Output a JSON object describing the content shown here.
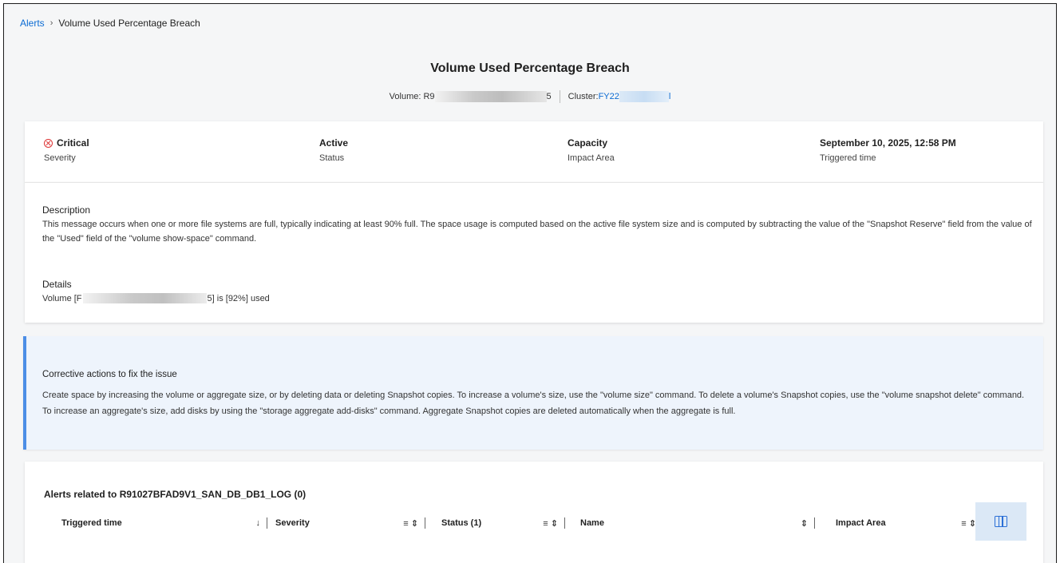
{
  "breadcrumb": {
    "link": "Alerts",
    "separator": "›",
    "current": "Volume Used Percentage Breach"
  },
  "header": {
    "title": "Volume Used Percentage Breach",
    "volume_label": "Volume: R9",
    "volume_suffix": "5",
    "cluster_label": "Cluster: ",
    "cluster_value": "FY22",
    "cluster_suffix": "l"
  },
  "summary": {
    "severity_value": "Critical",
    "severity_label": "Severity",
    "severity_icon": "critical-x-circle-icon",
    "status_value": "Active",
    "status_label": "Status",
    "impact_value": "Capacity",
    "impact_label": "Impact Area",
    "time_value": "September 10, 2025, 12:58 PM",
    "time_label": "Triggered time"
  },
  "description": {
    "heading": "Description",
    "text": "This message occurs when one or more file systems are full, typically indicating at least 90% full. The space usage is computed based on the active file system size and is computed by subtracting the value of the \"Snapshot Reserve\" field from the value of the \"Used\" field of the \"volume show-space\" command."
  },
  "details": {
    "heading": "Details",
    "prefix": "Volume [F",
    "suffix": "5] is [92%] used"
  },
  "corrective": {
    "heading": "Corrective actions to fix the issue",
    "text": "Create space by increasing the volume or aggregate size, or by deleting data or deleting Snapshot copies. To increase a volume's size, use the \"volume size\" command. To delete a volume's Snapshot copies, use the \"volume snapshot delete\" command. To increase an aggregate's size, add disks by using the \"storage aggregate add-disks\" command. Aggregate Snapshot copies are deleted automatically when the aggregate is full."
  },
  "alerts_related": {
    "title": "Alerts related to R91027BFAD9V1_SAN_DB_DB1_LOG (0)",
    "columns": [
      {
        "label": "Triggered time",
        "controls": "↓"
      },
      {
        "label": "Severity",
        "controls": "≡ ⇕"
      },
      {
        "label": "Status (1)",
        "controls": "≡ ⇕"
      },
      {
        "label": "Name",
        "controls": "⇕"
      },
      {
        "label": "Impact Area",
        "controls": "≡ ⇕"
      }
    ],
    "column_picker_icon": "columns-icon"
  },
  "colors": {
    "link": "#0b6bd3",
    "critical": "#dd3333",
    "accent_bar": "#4c8ee6",
    "corrective_bg": "#eef4fc"
  }
}
